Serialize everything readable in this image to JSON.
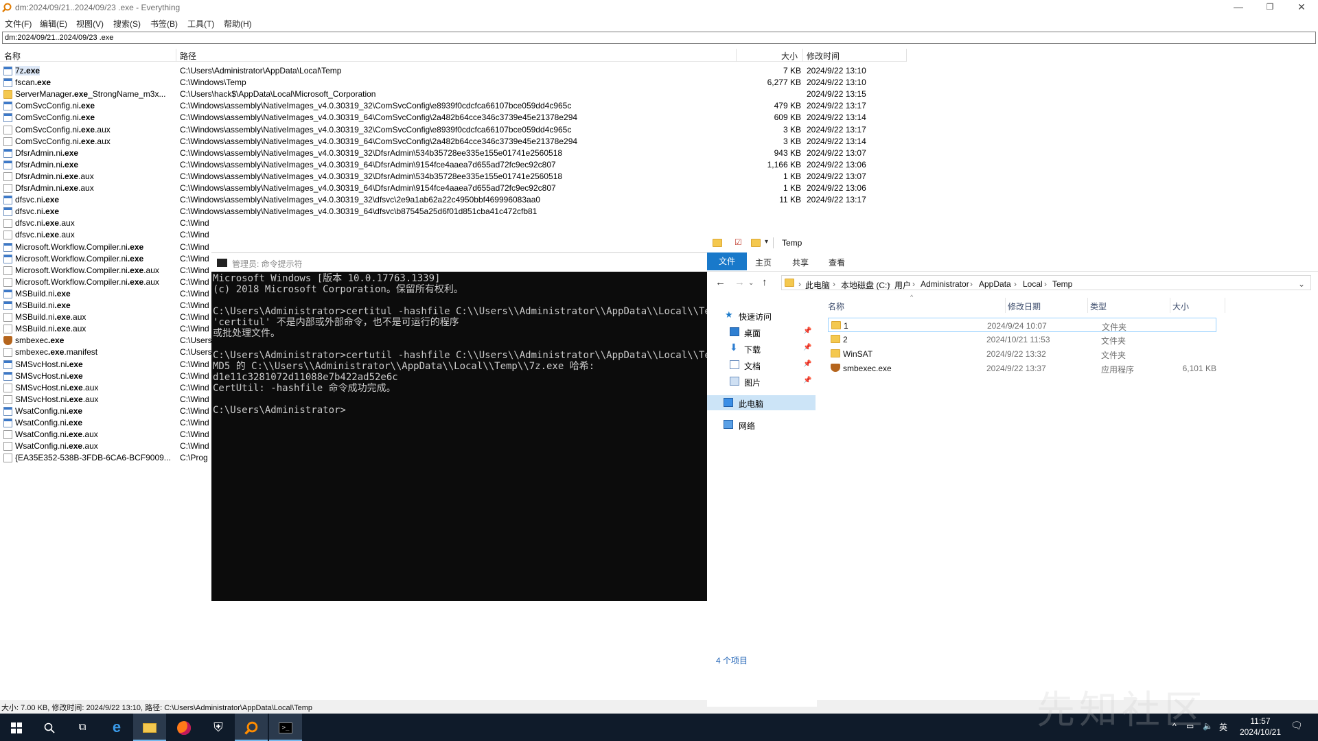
{
  "everything": {
    "title": "dm:2024/09/21..2024/09/23 .exe - Everything",
    "menu": [
      "文件(F)",
      "编辑(E)",
      "视图(V)",
      "搜索(S)",
      "书签(B)",
      "工具(T)",
      "帮助(H)"
    ],
    "search_value": "dm:2024/09/21..2024/09/23 .exe",
    "columns": {
      "name": "名称",
      "path": "路径",
      "size": "大小",
      "modified": "修改时间"
    },
    "rows": [
      {
        "pre": "7z",
        "hl": ".exe",
        "post": "",
        "path": "C:\\Users\\Administrator\\AppData\\Local\\Temp",
        "size": "7 KB",
        "date": "2024/9/22 13:10",
        "icon": "exe"
      },
      {
        "pre": "fscan",
        "hl": ".exe",
        "post": "",
        "path": "C:\\Windows\\Temp",
        "size": "6,277 KB",
        "date": "2024/9/22 13:10",
        "icon": "exe"
      },
      {
        "pre": "ServerManager",
        "hl": ".exe",
        "post": "_StrongName_m3x...",
        "path": "C:\\Users\\hack$\\AppData\\Local\\Microsoft_Corporation",
        "size": "",
        "date": "2024/9/22 13:15",
        "icon": "folder"
      },
      {
        "pre": "ComSvcConfig.ni",
        "hl": ".exe",
        "post": "",
        "path": "C:\\Windows\\assembly\\NativeImages_v4.0.30319_32\\ComSvcConfig\\e8939f0cdcfca66107bce059dd4c965c",
        "size": "479 KB",
        "date": "2024/9/22 13:17",
        "icon": "exe"
      },
      {
        "pre": "ComSvcConfig.ni",
        "hl": ".exe",
        "post": "",
        "path": "C:\\Windows\\assembly\\NativeImages_v4.0.30319_64\\ComSvcConfig\\2a482b64cce346c3739e45e21378e294",
        "size": "609 KB",
        "date": "2024/9/22 13:14",
        "icon": "exe"
      },
      {
        "pre": "ComSvcConfig.ni",
        "hl": ".exe",
        "post": ".aux",
        "path": "C:\\Windows\\assembly\\NativeImages_v4.0.30319_32\\ComSvcConfig\\e8939f0cdcfca66107bce059dd4c965c",
        "size": "3 KB",
        "date": "2024/9/22 13:17",
        "icon": "doc"
      },
      {
        "pre": "ComSvcConfig.ni",
        "hl": ".exe",
        "post": ".aux",
        "path": "C:\\Windows\\assembly\\NativeImages_v4.0.30319_64\\ComSvcConfig\\2a482b64cce346c3739e45e21378e294",
        "size": "3 KB",
        "date": "2024/9/22 13:14",
        "icon": "doc"
      },
      {
        "pre": "DfsrAdmin.ni",
        "hl": ".exe",
        "post": "",
        "path": "C:\\Windows\\assembly\\NativeImages_v4.0.30319_32\\DfsrAdmin\\534b35728ee335e155e01741e2560518",
        "size": "943 KB",
        "date": "2024/9/22 13:07",
        "icon": "exe"
      },
      {
        "pre": "DfsrAdmin.ni",
        "hl": ".exe",
        "post": "",
        "path": "C:\\Windows\\assembly\\NativeImages_v4.0.30319_64\\DfsrAdmin\\9154fce4aaea7d655ad72fc9ec92c807",
        "size": "1,166 KB",
        "date": "2024/9/22 13:06",
        "icon": "exe"
      },
      {
        "pre": "DfsrAdmin.ni",
        "hl": ".exe",
        "post": ".aux",
        "path": "C:\\Windows\\assembly\\NativeImages_v4.0.30319_32\\DfsrAdmin\\534b35728ee335e155e01741e2560518",
        "size": "1 KB",
        "date": "2024/9/22 13:07",
        "icon": "doc"
      },
      {
        "pre": "DfsrAdmin.ni",
        "hl": ".exe",
        "post": ".aux",
        "path": "C:\\Windows\\assembly\\NativeImages_v4.0.30319_64\\DfsrAdmin\\9154fce4aaea7d655ad72fc9ec92c807",
        "size": "1 KB",
        "date": "2024/9/22 13:06",
        "icon": "doc"
      },
      {
        "pre": "dfsvc.ni",
        "hl": ".exe",
        "post": "",
        "path": "C:\\Windows\\assembly\\NativeImages_v4.0.30319_32\\dfsvc\\2e9a1ab62a22c4950bbf469996083aa0",
        "size": "11 KB",
        "date": "2024/9/22 13:17",
        "icon": "exe"
      },
      {
        "pre": "dfsvc.ni",
        "hl": ".exe",
        "post": "",
        "path": "C:\\Windows\\assembly\\NativeImages_v4.0.30319_64\\dfsvc\\b87545a25d6f01d851cba41c472cfb81",
        "size": "",
        "date": "",
        "icon": "exe"
      },
      {
        "pre": "dfsvc.ni",
        "hl": ".exe",
        "post": ".aux",
        "path": "C:\\Wind",
        "size": "",
        "date": "",
        "icon": "doc"
      },
      {
        "pre": "dfsvc.ni",
        "hl": ".exe",
        "post": ".aux",
        "path": "C:\\Wind",
        "size": "",
        "date": "",
        "icon": "doc"
      },
      {
        "pre": "Microsoft.Workflow.Compiler.ni",
        "hl": ".exe",
        "post": "",
        "path": "C:\\Wind",
        "size": "",
        "date": "",
        "icon": "exe"
      },
      {
        "pre": "Microsoft.Workflow.Compiler.ni",
        "hl": ".exe",
        "post": "",
        "path": "C:\\Wind",
        "size": "",
        "date": "",
        "icon": "exe"
      },
      {
        "pre": "Microsoft.Workflow.Compiler.ni",
        "hl": ".exe",
        "post": ".aux",
        "path": "C:\\Wind",
        "size": "",
        "date": "",
        "icon": "doc"
      },
      {
        "pre": "Microsoft.Workflow.Compiler.ni",
        "hl": ".exe",
        "post": ".aux",
        "path": "C:\\Wind",
        "size": "",
        "date": "",
        "icon": "doc"
      },
      {
        "pre": "MSBuild.ni",
        "hl": ".exe",
        "post": "",
        "path": "C:\\Wind",
        "size": "",
        "date": "",
        "icon": "exe"
      },
      {
        "pre": "MSBuild.ni",
        "hl": ".exe",
        "post": "",
        "path": "C:\\Wind",
        "size": "",
        "date": "",
        "icon": "exe"
      },
      {
        "pre": "MSBuild.ni",
        "hl": ".exe",
        "post": ".aux",
        "path": "C:\\Wind",
        "size": "",
        "date": "",
        "icon": "doc"
      },
      {
        "pre": "MSBuild.ni",
        "hl": ".exe",
        "post": ".aux",
        "path": "C:\\Wind",
        "size": "",
        "date": "",
        "icon": "doc"
      },
      {
        "pre": "smbexec",
        "hl": ".exe",
        "post": "",
        "path": "C:\\Users",
        "size": "",
        "date": "",
        "icon": "shield"
      },
      {
        "pre": "smbexec",
        "hl": ".exe",
        "post": ".manifest",
        "path": "C:\\Users",
        "size": "",
        "date": "",
        "icon": "doc"
      },
      {
        "pre": "SMSvcHost.ni",
        "hl": ".exe",
        "post": "",
        "path": "C:\\Wind",
        "size": "",
        "date": "",
        "icon": "exe"
      },
      {
        "pre": "SMSvcHost.ni",
        "hl": ".exe",
        "post": "",
        "path": "C:\\Wind",
        "size": "",
        "date": "",
        "icon": "exe"
      },
      {
        "pre": "SMSvcHost.ni",
        "hl": ".exe",
        "post": ".aux",
        "path": "C:\\Wind",
        "size": "",
        "date": "",
        "icon": "doc"
      },
      {
        "pre": "SMSvcHost.ni",
        "hl": ".exe",
        "post": ".aux",
        "path": "C:\\Wind",
        "size": "",
        "date": "",
        "icon": "doc"
      },
      {
        "pre": "WsatConfig.ni",
        "hl": ".exe",
        "post": "",
        "path": "C:\\Wind",
        "size": "",
        "date": "",
        "icon": "exe"
      },
      {
        "pre": "WsatConfig.ni",
        "hl": ".exe",
        "post": "",
        "path": "C:\\Wind",
        "size": "",
        "date": "",
        "icon": "exe"
      },
      {
        "pre": "WsatConfig.ni",
        "hl": ".exe",
        "post": ".aux",
        "path": "C:\\Wind",
        "size": "",
        "date": "",
        "icon": "doc"
      },
      {
        "pre": "WsatConfig.ni",
        "hl": ".exe",
        "post": ".aux",
        "path": "C:\\Wind",
        "size": "",
        "date": "",
        "icon": "doc"
      },
      {
        "pre": "{EA35E352-538B-3FDB-6CA6-BCF9009...",
        "hl": "",
        "post": "",
        "path": "C:\\Prog",
        "size": "",
        "date": "",
        "icon": "doc"
      }
    ],
    "status": "大小: 7.00 KB, 修改时间: 2024/9/22 13:10, 路径: C:\\Users\\Administrator\\AppData\\Local\\Temp"
  },
  "cmd": {
    "title": "管理员: 命令提示符",
    "lines": [
      "Microsoft Windows [版本 10.0.17763.1339]",
      "(c) 2018 Microsoft Corporation。保留所有权利。",
      "",
      "C:\\Users\\Administrator>certitul -hashfile C:\\\\Users\\\\Administrator\\\\AppData\\\\Local\\\\Temp\\\\",
      "'certitul' 不是内部或外部命令，也不是可运行的程序",
      "或批处理文件。",
      "",
      "C:\\Users\\Administrator>certutil -hashfile C:\\\\Users\\\\Administrator\\\\AppData\\\\Local\\\\Temp\\\\",
      "MD5 的 C:\\\\Users\\\\Administrator\\\\AppData\\\\Local\\\\Temp\\\\7z.exe 哈希:",
      "d1e11c3281072d11088e7b422ad52e6c",
      "CertUtil: -hashfile 命令成功完成。",
      "",
      "C:\\Users\\Administrator>"
    ]
  },
  "explorer": {
    "quick_title": "Temp",
    "ribbon": {
      "file": "文件",
      "home": "主页",
      "share": "共享",
      "view": "查看"
    },
    "breadcrumb": [
      "此电脑",
      "本地磁盘 (C:)",
      "用户",
      "Administrator",
      "AppData",
      "Local",
      "Temp"
    ],
    "nav": {
      "quick_access": "快速访问",
      "desktop": "桌面",
      "downloads": "下载",
      "documents": "文档",
      "pictures": "图片",
      "this_pc": "此电脑",
      "network": "网络"
    },
    "columns": {
      "name": "名称",
      "date": "修改日期",
      "type": "类型",
      "size": "大小"
    },
    "files": [
      {
        "name": "1",
        "date": "2024/9/24 10:07",
        "type": "文件夹",
        "size": "",
        "icon": "folder"
      },
      {
        "name": "2",
        "date": "2024/10/21 11:53",
        "type": "文件夹",
        "size": "",
        "icon": "folder"
      },
      {
        "name": "WinSAT",
        "date": "2024/9/22 13:32",
        "type": "文件夹",
        "size": "",
        "icon": "folder"
      },
      {
        "name": "smbexec.exe",
        "date": "2024/9/22 13:37",
        "type": "应用程序",
        "size": "6,101 KB",
        "icon": "shield"
      }
    ],
    "item_count": "4 个项目"
  },
  "taskbar": {
    "time": "11:57",
    "date": "2024/10/21",
    "ime": "英"
  },
  "watermark": "先知社区",
  "colors": {
    "accent": "#1979ca",
    "taskbar": "#0f1b2a",
    "console_bg": "#0c0c0c",
    "console_fg": "#cccccc"
  }
}
